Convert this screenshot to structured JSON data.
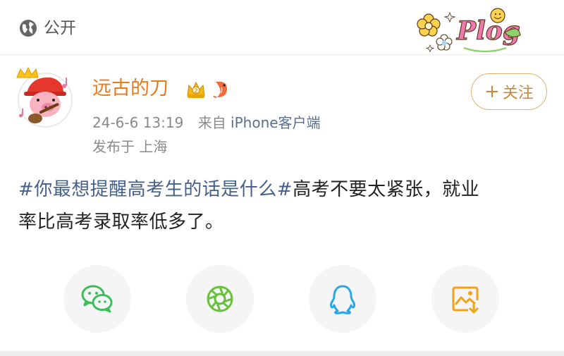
{
  "header": {
    "visibility_label": "公开",
    "globe_icon": "globe-icon",
    "sticker": "Plog"
  },
  "post": {
    "author": {
      "name": "远古的刀",
      "avatar": "pig-with-guitar-avatar",
      "badges": [
        "crown-badge",
        "shrimp-badge"
      ]
    },
    "time": "24-6-6 13:19",
    "source_prefix": "来自",
    "source_client": "iPhone客户端",
    "location": "发布于 上海",
    "follow_label": "关注",
    "hashtag": "#你最想提醒高考生的话是什么#",
    "content_line1_rest": "高考不要太紧张，就业",
    "content_line2": "率比高考录取率低多了。"
  },
  "share": {
    "items": [
      {
        "icon": "wechat-icon",
        "color": "#3cbf5a"
      },
      {
        "icon": "moments-icon",
        "color": "#67c23a"
      },
      {
        "icon": "qq-icon",
        "color": "#2aa7e8"
      },
      {
        "icon": "save-image-icon",
        "color": "#f2a219"
      }
    ]
  },
  "colors": {
    "author_name": "#ea7a20",
    "hashtag": "#45608a",
    "follow_border": "#e3b06d",
    "meta_text": "#8a8a8a"
  }
}
